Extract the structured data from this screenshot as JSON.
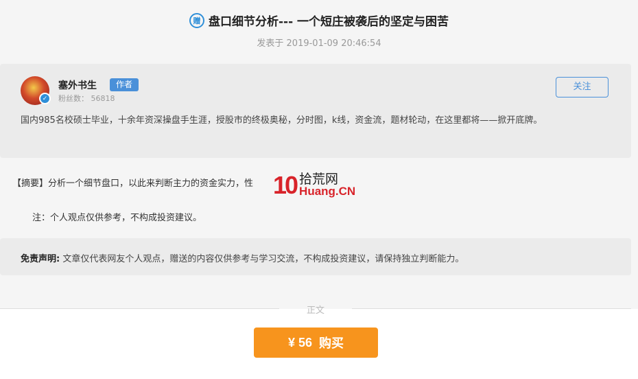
{
  "article": {
    "gift_icon_label": "赠",
    "title": "盘口细节分析--- 一个短庄被袭后的坚定与困苦",
    "date": "发表于 2019-01-09 20:46:54"
  },
  "author": {
    "name": "塞外书生",
    "badge": "作者",
    "fans": "粉丝数： 56818",
    "follow_label": "关注",
    "bio": "国内985名校硕士毕业，十余年资深操盘手生涯，授股市的终极奥秘，分时图，k线，资金流，题材轮动，在这里都将——掀开底牌。"
  },
  "summary": {
    "text": "【摘要】分析一个细节盘口，以此来判断主力的资金实力，性"
  },
  "watermark": {
    "logo": "10",
    "cn": "拾荒网",
    "en": "Huang.CN"
  },
  "note": "注：个人观点仅供参考，不构成投资建议。",
  "disclaimer": {
    "label": "免责声明:",
    "text": " 文章仅代表网友个人观点，赠送的内容仅供参考与学习交流，不构成投资建议，请保持独立判断能力。"
  },
  "divider_label": "正文",
  "buy": {
    "price": "¥ 56",
    "label": "购买"
  },
  "colors": {
    "accent": "#4a90d9",
    "buy": "#f7941d",
    "watermark_red": "#d8232a"
  }
}
